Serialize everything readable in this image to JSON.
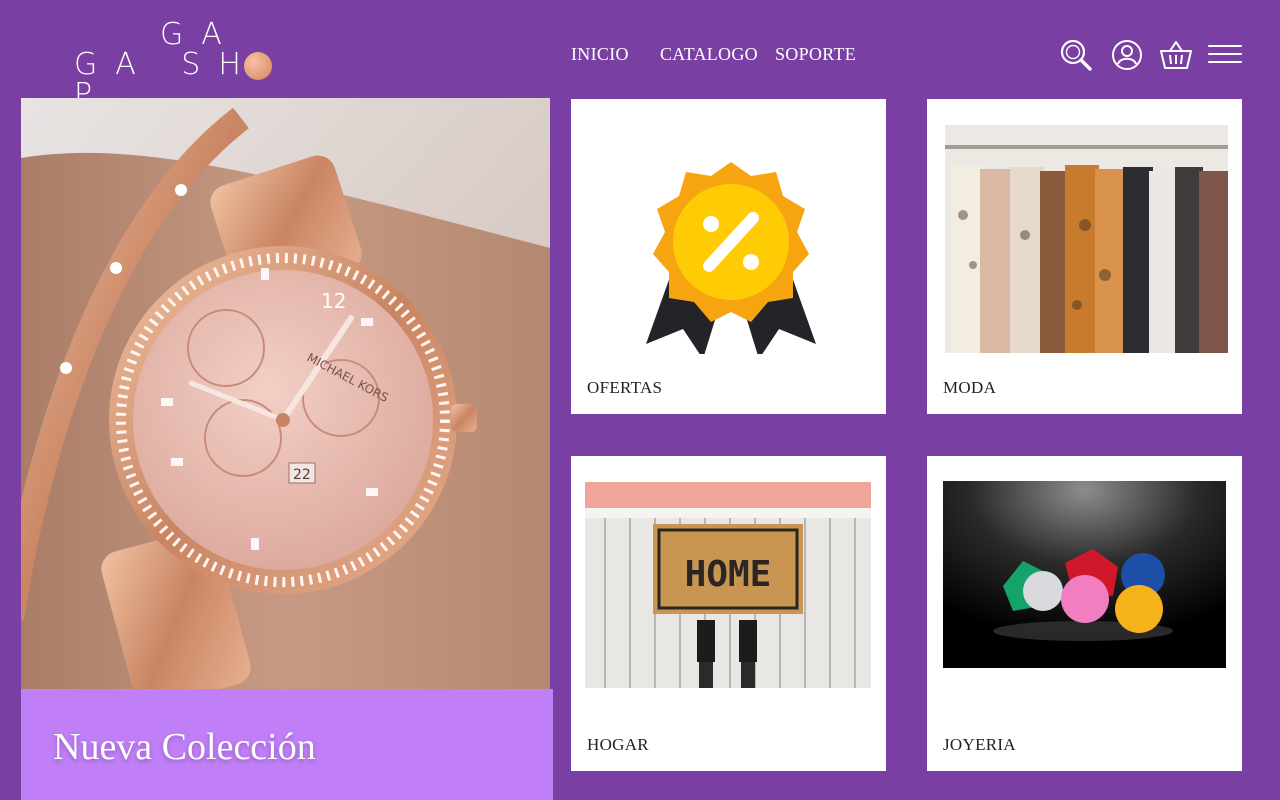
{
  "brand": {
    "logo_line1": "GA",
    "logo_line2": "GA SH P",
    "accent_color": "#7a3fa3",
    "banner_color": "#c07ef7"
  },
  "nav": {
    "items": [
      "INICIO",
      "CATALOGO",
      "SOPORTE"
    ]
  },
  "header_icons": [
    "search-icon",
    "user-icon",
    "basket-icon",
    "menu-icon"
  ],
  "hero": {
    "title": "Nueva Colección",
    "watch_brand_text": "MICHAEL KORS",
    "watch_date": "22",
    "watch_numeral": "12"
  },
  "categories": [
    {
      "label": "OFERTAS"
    },
    {
      "label": "MODA"
    },
    {
      "label": "HOGAR",
      "doormat_text": "HOME"
    },
    {
      "label": "JOYERIA"
    }
  ]
}
